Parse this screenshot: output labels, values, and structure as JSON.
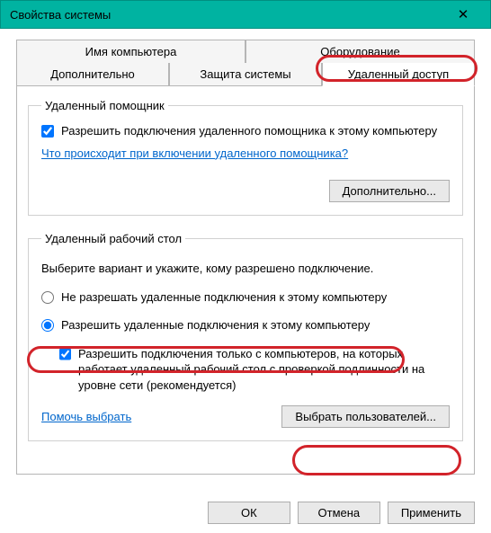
{
  "window": {
    "title": "Свойства системы",
    "close": "✕"
  },
  "tabs": {
    "r1c1": "Имя компьютера",
    "r1c2": "Оборудование",
    "r2c1": "Дополнительно",
    "r2c2": "Защита системы",
    "r2c3": "Удаленный доступ"
  },
  "assistant": {
    "legend": "Удаленный помощник",
    "allow": "Разрешить подключения удаленного помощника к этому компьютеру",
    "link": "Что происходит при включении удаленного помощника?",
    "advanced_btn": "Дополнительно..."
  },
  "rdp": {
    "legend": "Удаленный рабочий стол",
    "instr": "Выберите вариант и укажите, кому разрешено подключение.",
    "deny": "Не разрешать удаленные подключения к этому компьютеру",
    "allow": "Разрешить удаленные подключения к этому компьютеру",
    "nla": "Разрешить подключения только с компьютеров, на которых работает удаленный рабочий стол с проверкой подлинности на уровне сети (рекомендуется)",
    "help": "Помочь выбрать",
    "users_btn": "Выбрать пользователей..."
  },
  "footer": {
    "ok": "ОК",
    "cancel": "Отмена",
    "apply": "Применить"
  }
}
